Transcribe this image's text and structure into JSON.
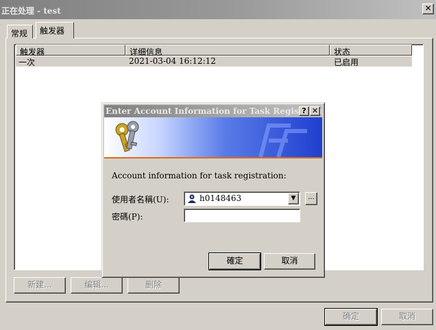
{
  "window": {
    "title": "正在处理 - test",
    "close_glyph": "✕"
  },
  "tabs": [
    {
      "label": "常规"
    },
    {
      "label": "触发器"
    }
  ],
  "triggers_list": {
    "columns": [
      "触发器",
      "详细信息",
      "状态"
    ],
    "rows": [
      {
        "trigger": "一次",
        "details": "2021-03-04 16:12:12",
        "status": "已启用"
      }
    ]
  },
  "list_buttons": {
    "new": "新建...",
    "edit": "编辑...",
    "delete": "删除"
  },
  "main_buttons": {
    "ok": "确定",
    "cancel": "取消"
  },
  "dialog": {
    "title": "Enter Account Information for Task Registration",
    "help_glyph": "?",
    "close_glyph": "✕",
    "description": "Account information for task registration:",
    "username_label": "使用者名稱(U):",
    "username_value": "h0148463",
    "username_icon": "user-icon",
    "browse_label": "...",
    "password_label": "密碼(P):",
    "password_value": "",
    "ok": "確定",
    "cancel": "取消"
  },
  "colors": {
    "face": "#d4d0c8",
    "title_inactive": "#808080",
    "banner_blue": "#1f3fd0",
    "banner_accent": "#e06a1a"
  }
}
